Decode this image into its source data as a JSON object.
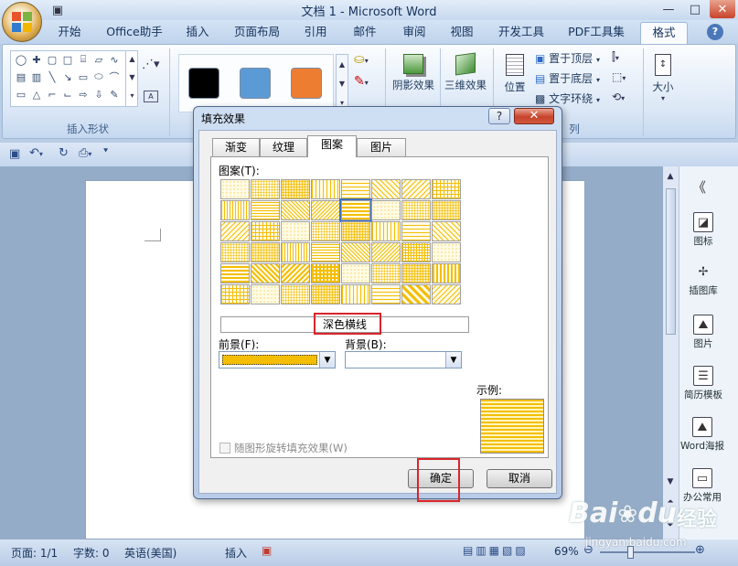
{
  "app": {
    "title": "文档 1 - Microsoft Word"
  },
  "window_controls": {
    "minimize": "—",
    "maximize": "□",
    "close": "✕"
  },
  "tabs": [
    {
      "label": "开始"
    },
    {
      "label": "Office助手"
    },
    {
      "label": "插入"
    },
    {
      "label": "页面布局"
    },
    {
      "label": "引用"
    },
    {
      "label": "邮件"
    },
    {
      "label": "审阅"
    },
    {
      "label": "视图"
    },
    {
      "label": "开发工具"
    },
    {
      "label": "PDF工具集"
    }
  ],
  "active_tab": {
    "label": "格式"
  },
  "help": "?",
  "ribbon": {
    "insert_shapes": {
      "label": "插入形状"
    },
    "shape_styles": {
      "colors": [
        "#000000",
        "#5b9bd5",
        "#ed7d31"
      ]
    },
    "shadow": {
      "label": "阴影效果"
    },
    "threed": {
      "label": "三维效果"
    },
    "arrange": {
      "position": "位置",
      "bring_front": "置于顶层",
      "send_back": "置于底层",
      "text_wrap": "文字环绕",
      "group_label": "列"
    },
    "size": {
      "label": "大小"
    }
  },
  "sidebar": {
    "collapse": "《",
    "items": [
      {
        "label": "图标"
      },
      {
        "label": "插图库"
      },
      {
        "label": "图片"
      },
      {
        "label": "简历模板"
      },
      {
        "label": "Word海报"
      },
      {
        "label": "办公常用"
      }
    ]
  },
  "status": {
    "page": "页面: 1/1",
    "words": "字数: 0",
    "lang": "英语(美国)",
    "mode": "插入",
    "zoom": "69%"
  },
  "dialog": {
    "title": "填充效果",
    "help": "?",
    "close": "✕",
    "tabs": [
      {
        "label": "渐变"
      },
      {
        "label": "纹理"
      },
      {
        "label": "图案"
      },
      {
        "label": "图片"
      }
    ],
    "pattern_label": "图案(T):",
    "selected_pattern_name": "深色横线",
    "foreground_label": "前景(F):",
    "background_label": "背景(B):",
    "foreground_color": "#f4be07",
    "sample_label": "示例:",
    "rotate_label": "随图形旋转填充效果(W)",
    "ok": "确定",
    "cancel": "取消"
  },
  "watermark": {
    "brand": "Bai",
    "brand2": "du",
    "suffix": "经验",
    "url": "jingyan.baidu.com"
  }
}
